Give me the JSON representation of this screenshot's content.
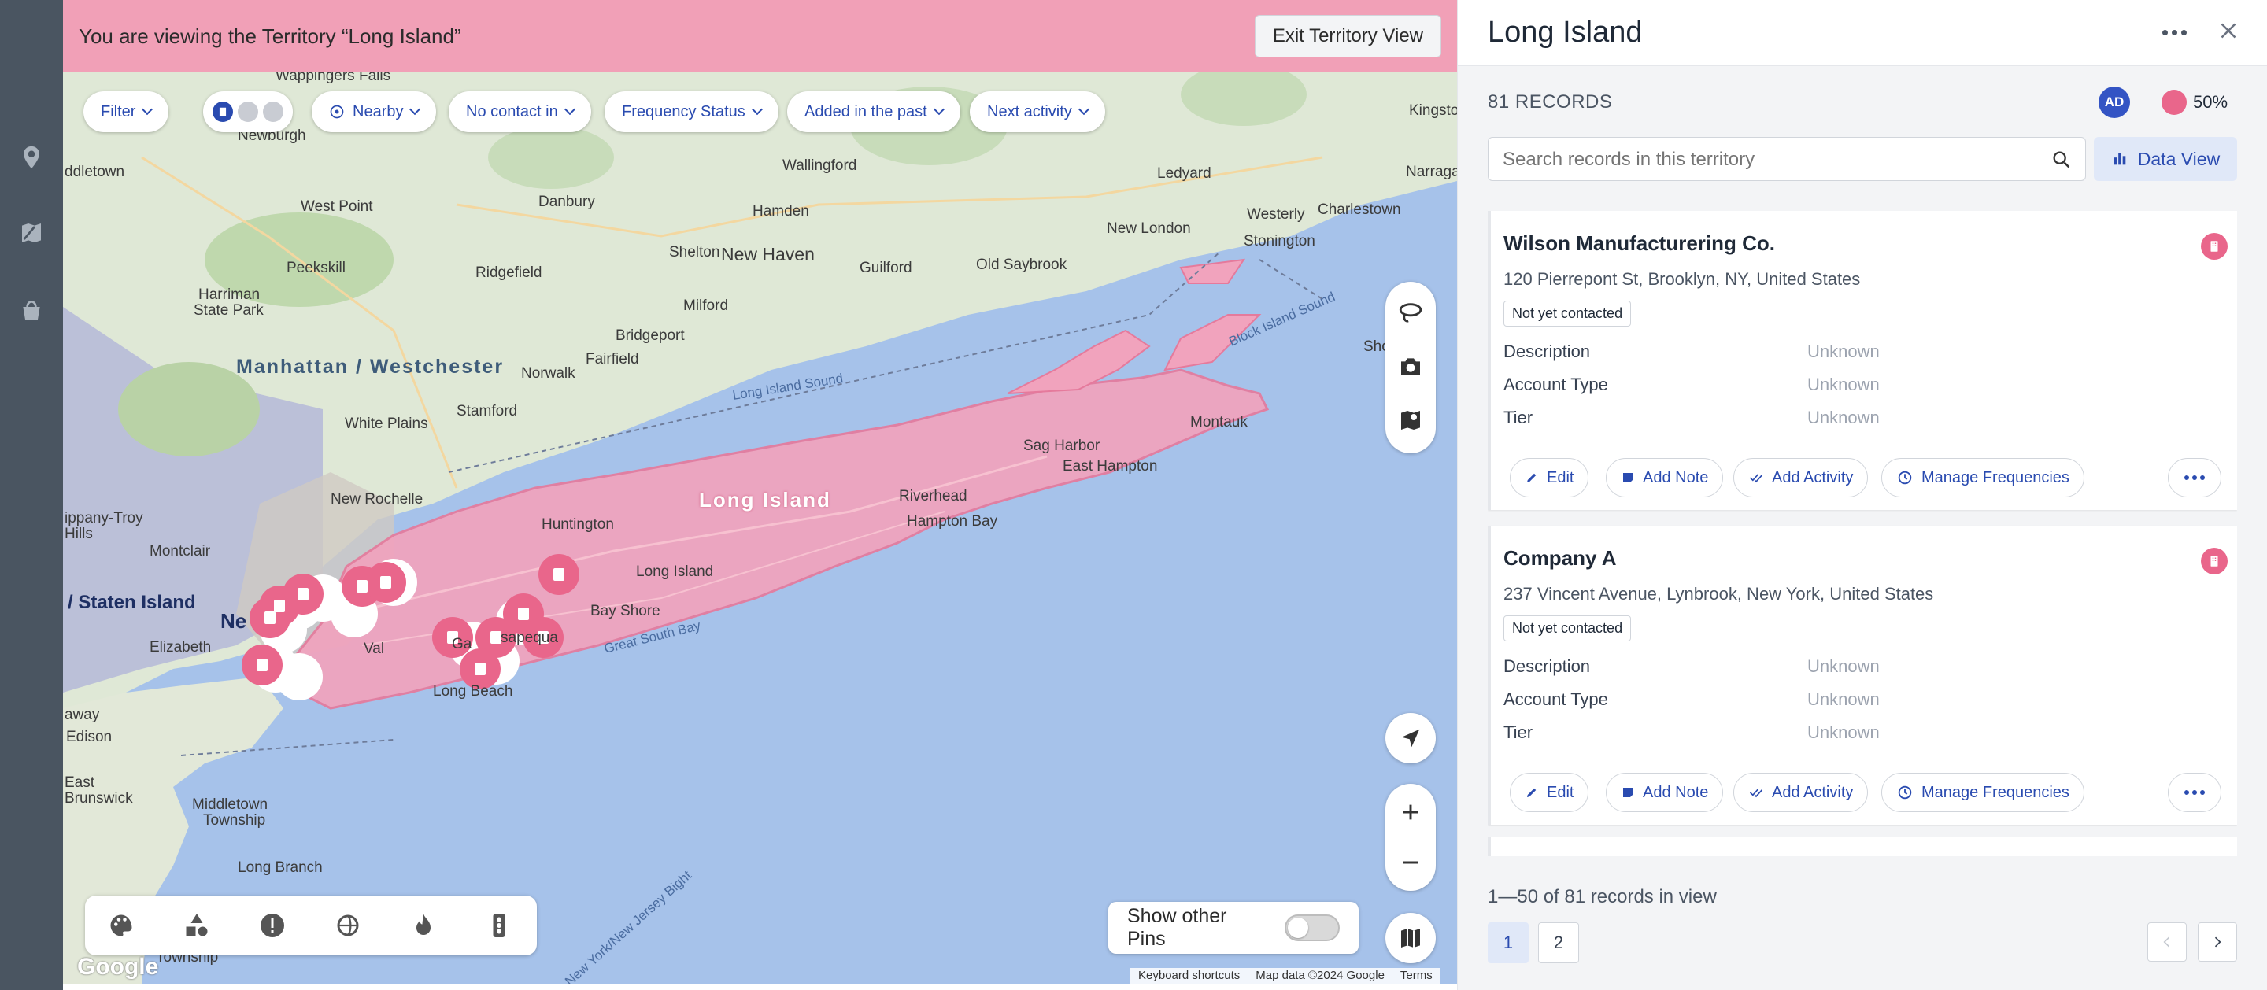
{
  "banner": {
    "message": "You are viewing the Territory “Long Island”",
    "exit_label": "Exit Territory View"
  },
  "filters": {
    "filter": "Filter",
    "nearby": "Nearby",
    "no_contact": "No contact in",
    "frequency": "Frequency Status",
    "added": "Added in the past",
    "next_activity": "Next activity"
  },
  "map": {
    "places": {
      "wappingers": "Wappingers Falls",
      "newburgh": "Newburgh",
      "middletown": "ddletown",
      "west_point": "West Point",
      "harriman": "Harriman",
      "state_park": "State Park",
      "peekskill": "Peekskill",
      "danbury": "Danbury",
      "ridgefield": "Ridgefield",
      "hamden": "Hamden",
      "wallingford": "Wallingford",
      "new_haven": "New Haven",
      "shelton": "Shelton",
      "milford": "Milford",
      "guilford": "Guilford",
      "old_saybrook": "Old Saybrook",
      "ledyard": "Ledyard",
      "new_london": "New London",
      "stonington": "Stonington",
      "westerly": "Westerly",
      "charlestown": "Charlestown",
      "narragansett": "Narraga",
      "kingston": "Kingsto",
      "bridgeport": "Bridgeport",
      "fairfield": "Fairfield",
      "norwalk": "Norwalk",
      "stamford": "Stamford",
      "white_plains": "White Plains",
      "new_rochelle": "New Rochelle",
      "parsippany": "ippany-Troy",
      "hills": "Hills",
      "montclair": "Montclair",
      "elizabeth": "Elizabeth",
      "staten_island": "/ Staten Island",
      "newark": "Ne",
      "rahway": "away",
      "edison": "Edison",
      "brunswick": "Brunswick",
      "east": "East",
      "middletown_twp": "Middletown",
      "township": "Township",
      "long_branch": "Long Branch",
      "township2": "Township",
      "huntington": "Huntington",
      "riverhead": "Riverhead",
      "sag_harbor": "Sag Harbor",
      "east_hampton": "East Hampton",
      "hampton_bay": "Hampton Bay",
      "montauk": "Montauk",
      "bay_shore": "Bay Shore",
      "long_island_small": "Long Island",
      "massapequa": "sapequa",
      "valley": "Val",
      "garden": "Ga",
      "long_beach": "Long Beach",
      "shore": "Shor"
    },
    "water": {
      "long_island_sound": "Long Island Sound",
      "block_island_sound": "Block Island Sound",
      "great_south_bay": "Great South Bay",
      "ny_bight": "New York/New Jersey Bight"
    },
    "regions": {
      "manhattan": "Manhattan / Westchester",
      "long_island": "Long Island"
    },
    "google": "Google",
    "attribution": [
      "Keyboard shortcuts",
      "Map data ©2024 Google",
      "Terms"
    ]
  },
  "show_pins": {
    "label": "Show other Pins",
    "enabled": false
  },
  "panel": {
    "title": "Long Island",
    "records_count": "81 RECORDS",
    "avatar": "AD",
    "opacity": "50%",
    "search_placeholder": "Search records in this territory",
    "data_view": "Data View",
    "field_labels": {
      "description": "Description",
      "account_type": "Account Type",
      "tier": "Tier"
    },
    "actions": {
      "edit": "Edit",
      "add_note": "Add Note",
      "add_activity": "Add Activity",
      "manage_frequencies": "Manage Frequencies"
    },
    "records": [
      {
        "name": "Wilson Manufacturering Co.",
        "address": "120 Pierrepont St, Brooklyn, NY, United States",
        "status": "Not yet contacted",
        "description": "Unknown",
        "account_type": "Unknown",
        "tier": "Unknown"
      },
      {
        "name": "Company A",
        "address": "237 Vincent Avenue, Lynbrook, New York, United States",
        "status": "Not yet contacted",
        "description": "Unknown",
        "account_type": "Unknown",
        "tier": "Unknown"
      }
    ],
    "pagination": {
      "summary": "1—50 of 81 records in view",
      "pages": [
        "1",
        "2"
      ],
      "current": "1"
    }
  },
  "colors": {
    "accent": "#2a4bb0",
    "territory": "#f1a0b7",
    "pin": "#e9668b",
    "rail": "#4a5561"
  },
  "icons": {
    "rail": [
      "map-pin-icon",
      "map-draw-icon",
      "shopping-bag-icon"
    ],
    "map_tools": [
      "lasso-icon",
      "camera-icon",
      "map-layers-icon",
      "locate-arrow-icon",
      "zoom-in-icon",
      "zoom-out-icon",
      "map-type-icon"
    ],
    "palette": [
      "palette-icon",
      "shapes-icon",
      "alert-icon",
      "globe-refresh-icon",
      "flame-icon",
      "traffic-light-icon"
    ]
  }
}
